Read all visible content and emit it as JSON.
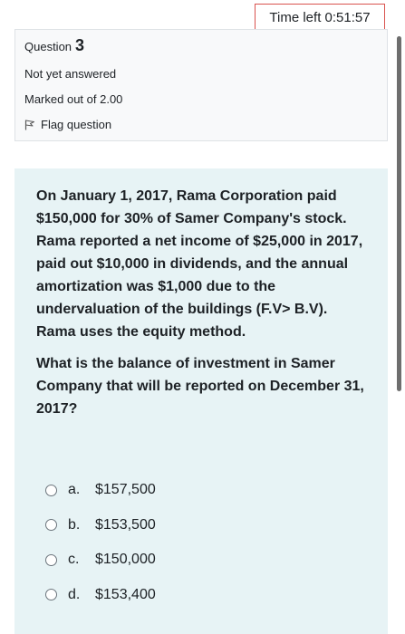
{
  "timer": {
    "label": "Time left 0:51:57"
  },
  "info": {
    "question_label": "Question",
    "question_number": "3",
    "status": "Not yet answered",
    "marks": "Marked out of 2.00",
    "flag_label": "Flag question"
  },
  "question": {
    "paragraph1": "On January 1, 2017, Rama Corporation paid $150,000 for 30% of Samer Company's stock. Rama reported a net income of $25,000 in 2017, paid out $10,000 in dividends, and the annual amortization was $1,000 due to the undervaluation of the buildings (F.V> B.V). Rama uses the equity method.",
    "paragraph2": "What is the balance of investment in Samer Company that will be reported on December 31, 2017?"
  },
  "answers": [
    {
      "letter": "a.",
      "text": "$157,500"
    },
    {
      "letter": "b.",
      "text": "$153,500"
    },
    {
      "letter": "c.",
      "text": "$150,000"
    },
    {
      "letter": "d.",
      "text": "$153,400"
    }
  ],
  "colors": {
    "timer_border": "#d9534f",
    "info_bg": "#f8f9fa",
    "content_bg": "#e7f3f5"
  }
}
